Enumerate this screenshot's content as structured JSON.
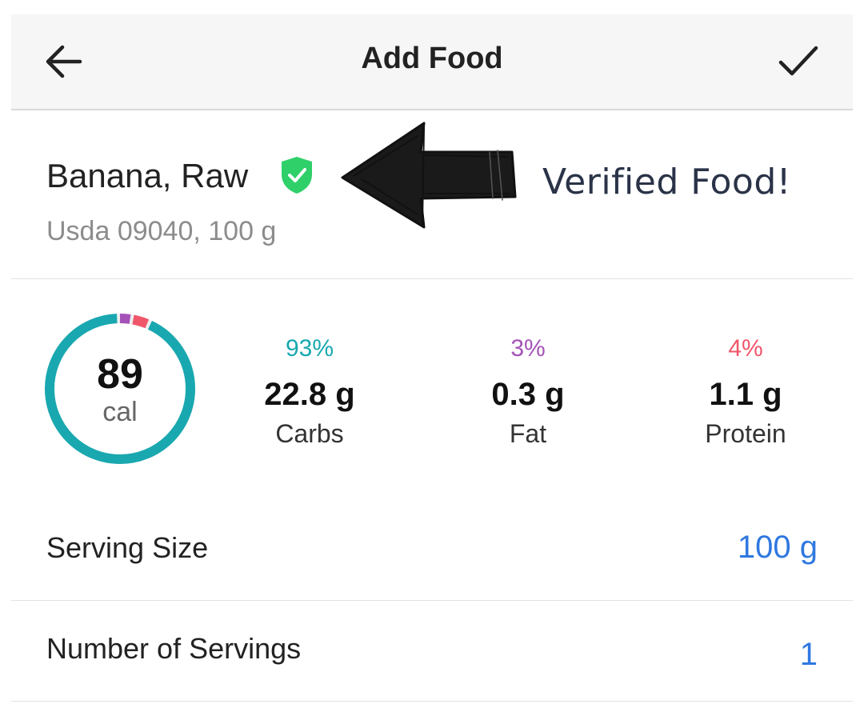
{
  "header": {
    "title": "Add Food",
    "back_icon": "arrow-left-icon",
    "confirm_icon": "checkmark-icon"
  },
  "food": {
    "name": "Banana, Raw",
    "subtitle": "Usda 09040, 100 g",
    "verified_icon": "verified-shield-icon",
    "verified_color": "#2fd06a"
  },
  "annotation": {
    "text": "Verified Food!",
    "arrow_icon": "hand-drawn-arrow-left"
  },
  "calories": {
    "value": "89",
    "unit": "cal"
  },
  "macros": [
    {
      "percent": "93%",
      "amount": "22.8 g",
      "label": "Carbs",
      "color": "#19a8b0",
      "fraction": 0.93
    },
    {
      "percent": "3%",
      "amount": "0.3 g",
      "label": "Fat",
      "color": "#a452b8",
      "fraction": 0.03
    },
    {
      "percent": "4%",
      "amount": "1.1 g",
      "label": "Protein",
      "color": "#f0566a",
      "fraction": 0.04
    }
  ],
  "serving": {
    "serving_size_label": "Serving Size",
    "serving_size_value": "100 g",
    "servings_label": "Number of Servings",
    "servings_value": "1"
  },
  "accent_color": "#2f78e0"
}
